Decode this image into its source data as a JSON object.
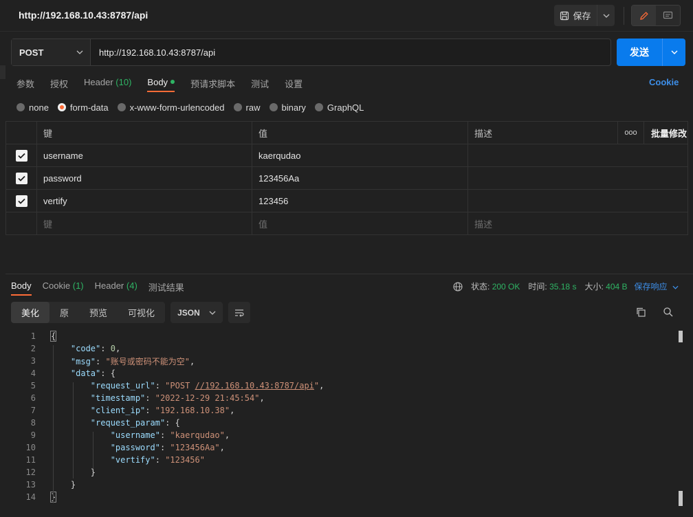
{
  "topbar": {
    "title": "http://192.168.10.43:8787/api",
    "save_label": "保存"
  },
  "request": {
    "method": "POST",
    "url": "http://192.168.10.43:8787/api",
    "send_label": "发送"
  },
  "request_tabs": {
    "params": "参数",
    "auth": "授权",
    "header": "Header",
    "header_count": "(10)",
    "body": "Body",
    "prerequest": "预请求脚本",
    "tests": "测试",
    "settings": "设置",
    "cookie": "Cookie"
  },
  "body_types": {
    "none": "none",
    "form_data": "form-data",
    "urlencoded": "x-www-form-urlencoded",
    "raw": "raw",
    "binary": "binary",
    "graphql": "GraphQL",
    "selected": "form-data"
  },
  "kv_table": {
    "headers": {
      "key": "键",
      "value": "值",
      "desc": "描述",
      "more": "ooo",
      "bulk": "批量修改"
    },
    "rows": [
      {
        "key": "username",
        "value": "kaerqudao",
        "desc": "",
        "checked": true
      },
      {
        "key": "password",
        "value": "123456Aa",
        "desc": "",
        "checked": true
      },
      {
        "key": "vertify",
        "value": "123456",
        "desc": "",
        "checked": true
      }
    ],
    "placeholder": {
      "key": "键",
      "value": "值",
      "desc": "描述"
    }
  },
  "response_tabs": {
    "body": "Body",
    "cookie": "Cookie",
    "cookie_count": "(1)",
    "header": "Header",
    "header_count": "(4)",
    "test_results": "测试结果"
  },
  "status": {
    "status_label": "状态:",
    "status_value": "200 OK",
    "time_label": "时间:",
    "time_value": "35.18 s",
    "size_label": "大小:",
    "size_value": "404 B",
    "save_response": "保存响应"
  },
  "view_modes": {
    "pretty": "美化",
    "raw": "原",
    "preview": "预览",
    "visualize": "可视化",
    "format": "JSON"
  },
  "response_body": {
    "code_key": "\"code\"",
    "code_value": "0",
    "msg_key": "\"msg\"",
    "msg_value": "\"账号或密码不能为空\"",
    "data_key": "\"data\"",
    "request_url_key": "\"request_url\"",
    "request_url_prefix": "\"POST ",
    "request_url_link": "//192.168.10.43:8787/api",
    "request_url_suffix": "\"",
    "timestamp_key": "\"timestamp\"",
    "timestamp_value": "\"2022-12-29 21:45:54\"",
    "client_ip_key": "\"client_ip\"",
    "client_ip_value": "\"192.168.10.38\"",
    "request_param_key": "\"request_param\"",
    "username_key": "\"username\"",
    "username_value": "\"kaerqudao\"",
    "password_key": "\"password\"",
    "password_value": "\"123456Aa\"",
    "vertify_key": "\"vertify\"",
    "vertify_value": "\"123456\""
  },
  "line_numbers": [
    "1",
    "2",
    "3",
    "4",
    "5",
    "6",
    "7",
    "8",
    "9",
    "10",
    "11",
    "12",
    "13",
    "14"
  ]
}
